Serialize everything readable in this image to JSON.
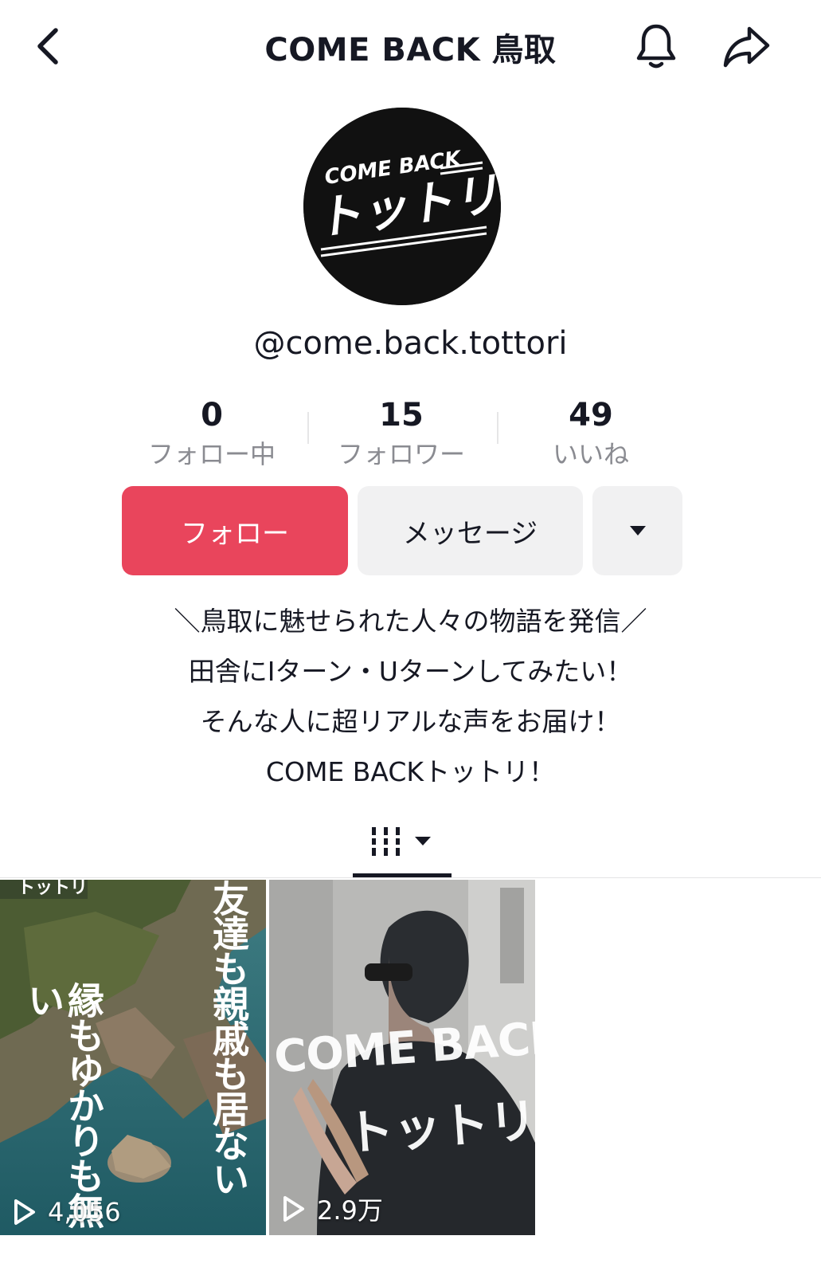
{
  "header": {
    "title": "COME BACK 鳥取",
    "back_icon": "chevron-left-icon",
    "notification_icon": "bell-icon",
    "share_icon": "share-arrow-icon"
  },
  "profile": {
    "avatar_text_top": "COME BACK",
    "avatar_text_main": "トットリ",
    "username": "@come.back.tottori"
  },
  "stats": [
    {
      "value": "0",
      "label": "フォロー中"
    },
    {
      "value": "15",
      "label": "フォロワー"
    },
    {
      "value": "49",
      "label": "いいね"
    }
  ],
  "actions": {
    "follow_label": "フォロー",
    "message_label": "メッセージ",
    "more_icon": "caret-down-icon",
    "follow_color": "#e9455c"
  },
  "bio": [
    "＼鳥取に魅せられた人々の物語を発信／",
    "田舎にIターン・Uターンしてみたい！",
    "そんな人に超リアルな声をお届け！",
    "COME BACKトットリ！"
  ],
  "tabs": {
    "videos_icon": "grid-bars-icon"
  },
  "videos": [
    {
      "views": "4,056",
      "overlay_text_right": "友達も親戚も居ない",
      "overlay_text_left": "縁もゆかりも無い",
      "overlay_text_corner": "トットリ"
    },
    {
      "views": "2.9万",
      "overlay_text_line1": "COME BACK",
      "overlay_text_line2": "トットリ"
    }
  ]
}
